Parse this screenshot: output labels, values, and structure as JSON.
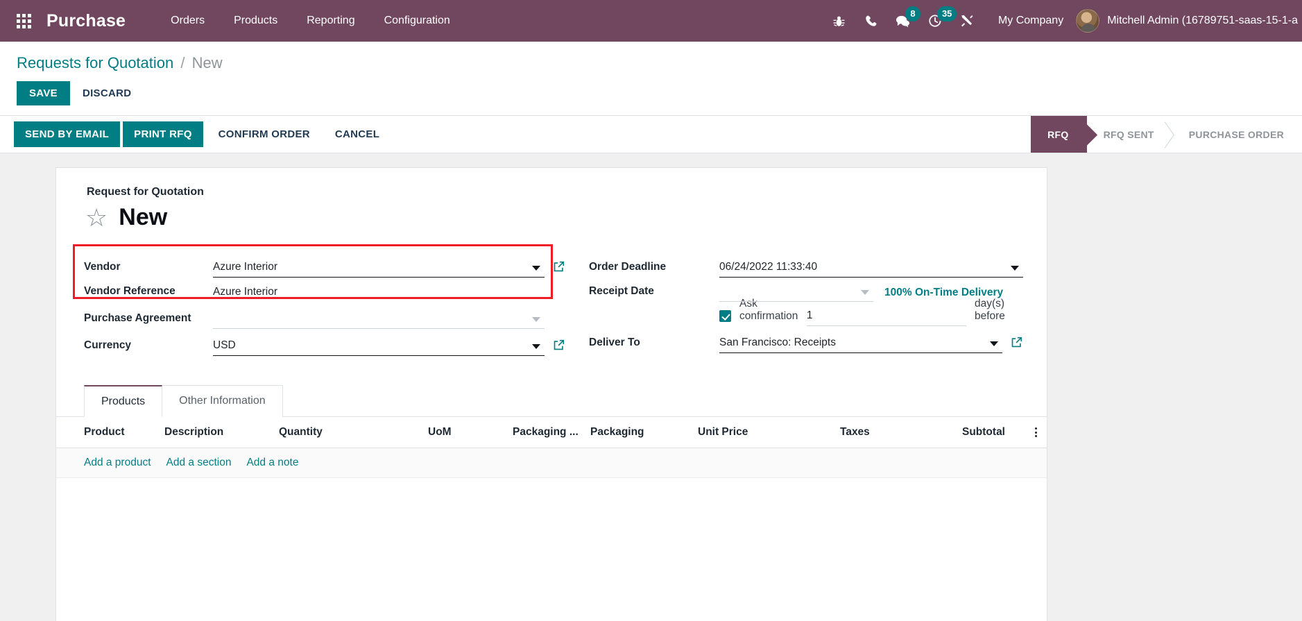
{
  "navbar": {
    "apps_icon": "apps-grid-icon",
    "brand": "Purchase",
    "menu": [
      "Orders",
      "Products",
      "Reporting",
      "Configuration"
    ],
    "icons": [
      {
        "name": "bug-icon",
        "badge": null
      },
      {
        "name": "phone-icon",
        "badge": null
      },
      {
        "name": "messages-icon",
        "badge": "8"
      },
      {
        "name": "activity-clock-icon",
        "badge": "35"
      },
      {
        "name": "tools-icon",
        "badge": null
      }
    ],
    "company": "My Company",
    "user": "Mitchell Admin (16789751-saas-15-1-a"
  },
  "control_panel": {
    "breadcrumb_root": "Requests for Quotation",
    "breadcrumb_sep": "/",
    "breadcrumb_current": "New",
    "save_label": "SAVE",
    "discard_label": "DISCARD"
  },
  "action_row": {
    "buttons": [
      {
        "label": "SEND BY EMAIL",
        "primary": true
      },
      {
        "label": "PRINT RFQ",
        "primary": true
      },
      {
        "label": "CONFIRM ORDER",
        "primary": false
      },
      {
        "label": "CANCEL",
        "primary": false
      }
    ],
    "statusbar": [
      {
        "label": "RFQ",
        "active": true
      },
      {
        "label": "RFQ SENT",
        "active": false
      },
      {
        "label": "PURCHASE ORDER",
        "active": false
      }
    ]
  },
  "form": {
    "section_label": "Request for Quotation",
    "star_icon": "star-outline-icon",
    "title": "New",
    "left": {
      "vendor_label": "Vendor",
      "vendor_value": "Azure Interior",
      "vendor_reference_label": "Vendor Reference",
      "vendor_reference_value": "Azure Interior",
      "purchase_agreement_label": "Purchase Agreement",
      "purchase_agreement_value": "",
      "currency_label": "Currency",
      "currency_value": "USD"
    },
    "right": {
      "order_deadline_label": "Order Deadline",
      "order_deadline_value": "06/24/2022 11:33:40",
      "receipt_date_label": "Receipt Date",
      "receipt_date_value": "",
      "on_time_delivery": "100% On-Time Delivery",
      "ask_confirmation_label": "Ask confirmation",
      "ask_confirmation_days": "1",
      "days_before_label": "day(s) before",
      "deliver_to_label": "Deliver To",
      "deliver_to_value": "San Francisco: Receipts"
    }
  },
  "notebook": {
    "tabs": [
      {
        "label": "Products",
        "active": true
      },
      {
        "label": "Other Information",
        "active": false
      }
    ],
    "columns": [
      "Product",
      "Description",
      "Quantity",
      "UoM",
      "Packaging ...",
      "Packaging",
      "Unit Price",
      "Taxes",
      "Subtotal"
    ],
    "options_icon": "vertical-dots-icon",
    "add_links": [
      "Add a product",
      "Add a section",
      "Add a note"
    ]
  },
  "colors": {
    "navbar_purple": "#71475f",
    "accent_teal": "#017e84",
    "highlight_red": "#ef1c25"
  }
}
